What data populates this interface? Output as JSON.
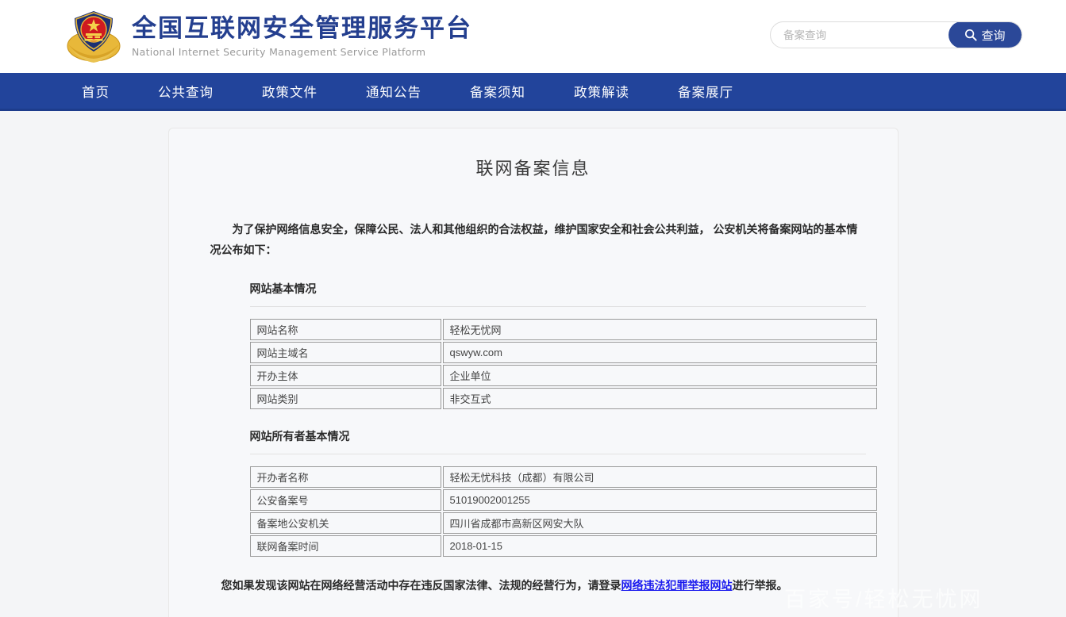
{
  "header": {
    "logo_icon": "police-badge-emblem",
    "brand_cn": "全国互联网安全管理服务平台",
    "brand_en": "National Internet Security Management Service Platform",
    "search": {
      "placeholder": "备案查询",
      "value": "",
      "button_label": "查询",
      "button_icon": "search-icon"
    }
  },
  "nav": {
    "items": [
      {
        "label": "首页"
      },
      {
        "label": "公共查询"
      },
      {
        "label": "政策文件"
      },
      {
        "label": "通知公告"
      },
      {
        "label": "备案须知"
      },
      {
        "label": "政策解读"
      },
      {
        "label": "备案展厅"
      }
    ]
  },
  "main": {
    "title": "联网备案信息",
    "intro": "为了保护网络信息安全，保障公民、法人和其他组织的合法权益，维护国家安全和社会公共利益， 公安机关将备案网站的基本情况公布如下：",
    "sections": [
      {
        "heading": "网站基本情况",
        "rows": [
          {
            "label": "网站名称",
            "value": "轻松无忧网"
          },
          {
            "label": "网站主域名",
            "value": "qswyw.com"
          },
          {
            "label": "开办主体",
            "value": "企业单位"
          },
          {
            "label": "网站类别",
            "value": "非交互式"
          }
        ]
      },
      {
        "heading": "网站所有者基本情况",
        "rows": [
          {
            "label": "开办者名称",
            "value": "轻松无忧科技（成都）有限公司"
          },
          {
            "label": "公安备案号",
            "value": "51019002001255"
          },
          {
            "label": "备案地公安机关",
            "value": "四川省成都市高新区网安大队"
          },
          {
            "label": "联网备案时间",
            "value": "2018-01-15"
          }
        ]
      }
    ],
    "footer_note": {
      "prefix": "您如果发现该网站在网络经营活动中存在违反国家法律、法规的经营行为，请登录",
      "link_text": "网络违法犯罪举报网站",
      "suffix": "进行举报。"
    }
  },
  "watermark": "百家号/轻松无忧网",
  "colors": {
    "brand_blue": "#243f8f",
    "nav_blue": "#22449b",
    "button_blue": "#2b4898",
    "link_blue": "#1a1aee",
    "page_bg": "#f4f5f7"
  }
}
